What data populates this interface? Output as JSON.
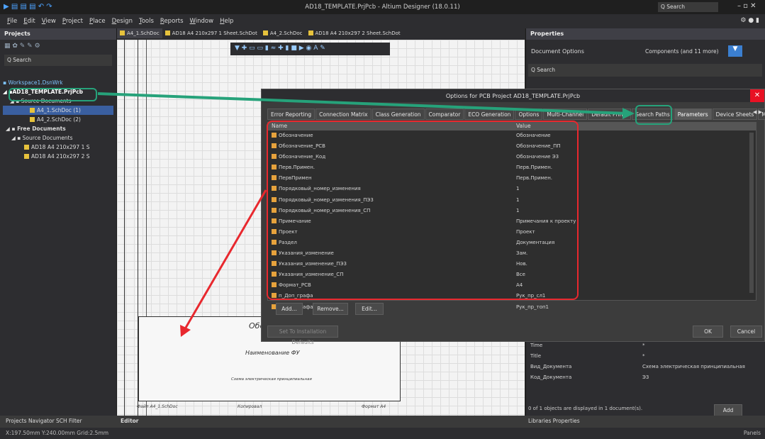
{
  "window": {
    "title": "AD18_TEMPLATE.PrjPcb - Altium Designer (18.0.11)",
    "search": "Q Search"
  },
  "menu": [
    "File",
    "Edit",
    "View",
    "Project",
    "Place",
    "Design",
    "Tools",
    "Reports",
    "Window",
    "Help"
  ],
  "projects": {
    "title": "Projects",
    "search": "Q Search",
    "workspace": "Workspace1.DsnWrk",
    "project": "AD18_TEMPLATE.PrjPcb",
    "source": "Source Documents",
    "doc1": "A4_1.SchDoc (1)",
    "doc2": "A4_2.SchDoc (2)",
    "free": "Free Documents",
    "free_source": "Source Documents",
    "free1": "AD18 A4 210x297 1 S",
    "free2": "AD18 A4 210x297 2 S"
  },
  "doc_tabs": [
    "A4_1.SchDoc",
    "AD18 A4 210x297 1 Sheet.SchDot",
    "A4_2.SchDoc",
    "AD18 A4 210x297 2 Sheet.SchDot"
  ],
  "properties": {
    "title": "Properties",
    "doc_options": "Document Options",
    "filter": "Components (and 11 more)",
    "search": "Q Search",
    "rows": [
      {
        "name": "Time",
        "value": "*"
      },
      {
        "name": "Title",
        "value": "*"
      },
      {
        "name": "Вид_Документа",
        "value": "Схема электрическая принципиальная"
      },
      {
        "name": "Код_Документа",
        "value": "Э3"
      }
    ],
    "add": "Add",
    "status": "0 of 1 objects are displayed in 1 document(s)."
  },
  "dialog": {
    "title": "Options for PCB Project AD18_TEMPLATE.PrjPcb",
    "tabs": [
      "Error Reporting",
      "Connection Matrix",
      "Class Generation",
      "Comparator",
      "ECO Generation",
      "Options",
      "Multi-Channel",
      "Default Prints",
      "Search Paths",
      "Parameters",
      "Device Sheets",
      "Managed Ou"
    ],
    "col_name": "Name",
    "col_value": "Value",
    "params": [
      [
        "Обозначение",
        "Обозначение"
      ],
      [
        "Обозначение_PCB",
        "Обозначение_ПП"
      ],
      [
        "Обозначение_Код",
        "Обозначение Э3"
      ],
      [
        "Перв.Примен.",
        "Перв.Примен."
      ],
      [
        "ПервПримен",
        "Перв.Примен."
      ],
      [
        "Порядковый_номер_изменения",
        "1"
      ],
      [
        "Порядковый_номер_изменения_ПЭ3",
        "1"
      ],
      [
        "Порядковый_номер_изменения_СП",
        "1"
      ],
      [
        "Примечание",
        "Примечания к проекту"
      ],
      [
        "Проект",
        "Проект"
      ],
      [
        "Раздел",
        "Документация"
      ],
      [
        "Указания_изменение",
        "Зам."
      ],
      [
        "Указания_изменение_ПЭ3",
        "Нов."
      ],
      [
        "Указания_изменение_СП",
        "Все"
      ],
      [
        "Формат_PCB",
        "A4"
      ],
      [
        "п_Доп_графа",
        "Рук_пр_сл1"
      ],
      [
        "п_Доп_графа_Р",
        "Рук_пр_топ1"
      ]
    ],
    "add": "Add...",
    "remove": "Remove...",
    "edit": "Edit...",
    "defaults": "Set To Installation Defaults",
    "ok": "OK",
    "cancel": "Cancel"
  },
  "sheet": {
    "name": "Наименование ФУ",
    "label": "Схема электрическая принципиальная",
    "file": "Файл  A4_1.SchDoc",
    "copied": "Копировал",
    "format": "Формат А4",
    "obozn": "Обоз"
  },
  "bottom": {
    "left_tabs": "Projects  Navigator  SCH Filter",
    "editor": "Editor",
    "right_tabs": "Libraries  Properties"
  },
  "status": {
    "coords": "X:197.50mm Y:240.00mm  Grid:2.5mm",
    "panels": "Panels"
  },
  "colors": {
    "highlight": "#26a27a",
    "arrow": "#e8282e",
    "accent": "#e6c23c"
  }
}
